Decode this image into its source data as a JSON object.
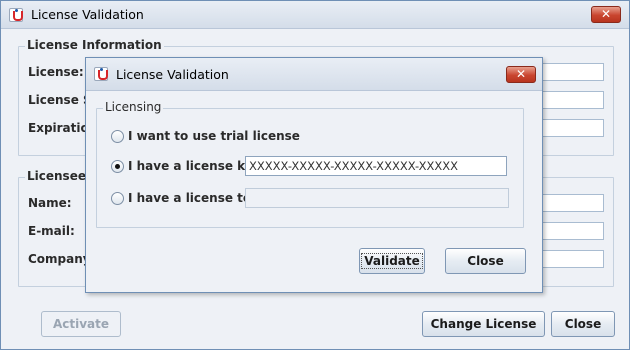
{
  "main_window": {
    "title": "License Validation",
    "close_label": "✕",
    "license_information": {
      "group_title": "License Information",
      "license_label": "License:",
      "license_status_label": "License St",
      "expiration_label": "Expiration"
    },
    "licensee_information": {
      "group_title": "Licensee In",
      "name_label": "Name:",
      "email_label": "E-mail:",
      "company_label": "Company:"
    },
    "buttons": {
      "activate": "Activate",
      "change_license": "Change License",
      "close": "Close"
    }
  },
  "dialog": {
    "title": "License Validation",
    "close_label": "✕",
    "group_title": "Licensing",
    "options": [
      {
        "label": "I want to use trial license",
        "selected": false
      },
      {
        "label": "I have a license key",
        "selected": true
      },
      {
        "label": "I have a license text",
        "selected": false
      }
    ],
    "license_key_value": "XXXXX-XXXXX-XXXXX-XXXXX-XXXXX",
    "license_text_value": "",
    "buttons": {
      "validate": "Validate",
      "close": "Close"
    }
  },
  "colors": {
    "window_bg": "#eef1f6",
    "close_button": "#c9452f",
    "border": "#6f8fb5"
  }
}
